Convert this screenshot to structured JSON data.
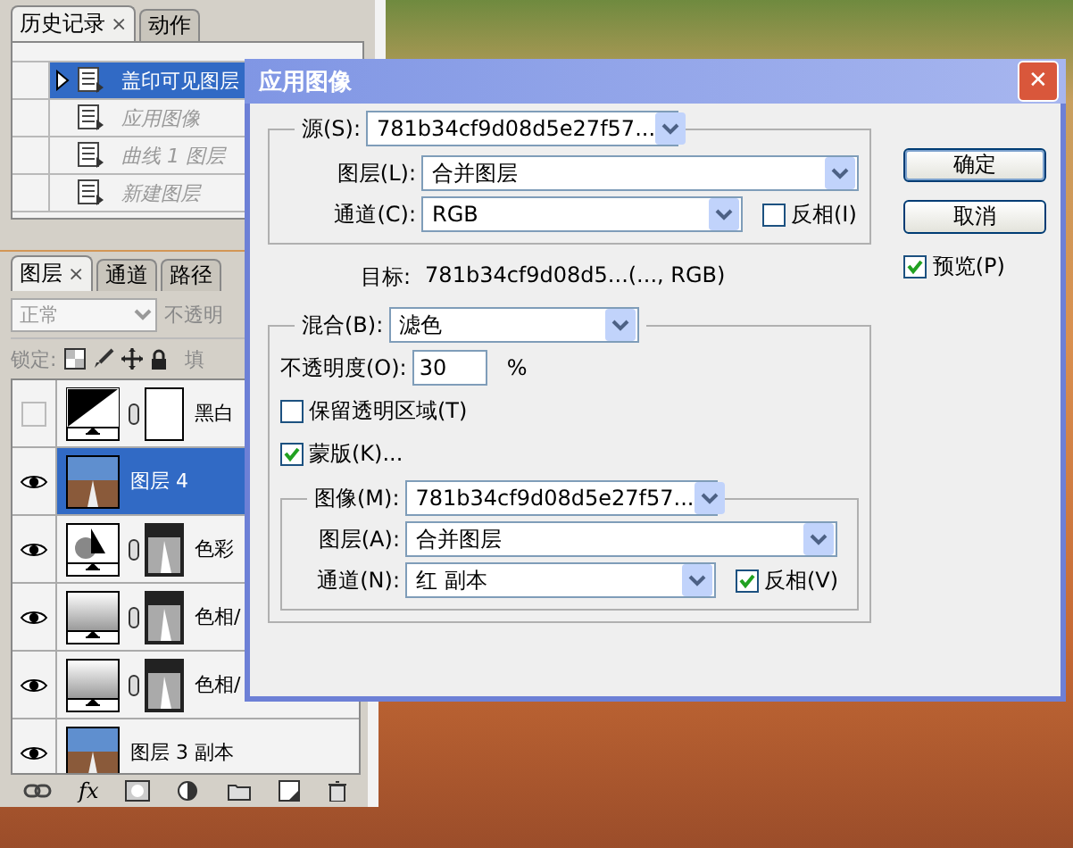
{
  "history_panel": {
    "tabs": [
      {
        "label": "历史记录",
        "selected": true,
        "close": "×"
      },
      {
        "label": "动作",
        "selected": false
      }
    ],
    "items": [
      {
        "label": "盖印可见图层",
        "selected": true,
        "undone": false
      },
      {
        "label": "应用图像",
        "selected": false,
        "undone": true
      },
      {
        "label": "曲线 1 图层",
        "selected": false,
        "undone": true
      },
      {
        "label": "新建图层",
        "selected": false,
        "undone": true
      }
    ]
  },
  "layers_panel": {
    "tabs": [
      {
        "label": "图层",
        "selected": true,
        "close": "×"
      },
      {
        "label": "通道",
        "selected": false
      },
      {
        "label": "路径",
        "selected": false
      }
    ],
    "effects_button": "fx",
    "blend_mode": {
      "value": "正常",
      "disabled": true
    },
    "opacity_label": "不透明",
    "lock_label": "锁定:",
    "fill_label": "填",
    "layers": [
      {
        "name": "黑白",
        "kind": "bw",
        "mask": {
          "kind": "white"
        },
        "visible": false,
        "selected": false
      },
      {
        "name": "图层 4",
        "kind": "photo",
        "visible": true,
        "selected": true
      },
      {
        "name": "色彩",
        "kind": "balance",
        "mask": {
          "kind": "image"
        },
        "visible": true,
        "selected": false
      },
      {
        "name": "色相/",
        "kind": "hue",
        "mask": {
          "kind": "image"
        },
        "visible": true,
        "selected": false
      },
      {
        "name": "色相/",
        "kind": "hue",
        "mask": {
          "kind": "image"
        },
        "visible": true,
        "selected": false
      },
      {
        "name": "图层 3 副本",
        "kind": "photo",
        "visible": true,
        "selected": false
      }
    ]
  },
  "dialog": {
    "title": "应用图像",
    "close": "✕",
    "source": {
      "label": "源(S):",
      "value": "781b34cf9d08d5e27f57..."
    },
    "layer": {
      "label": "图层(L):",
      "value": "合并图层"
    },
    "channel": {
      "label": "通道(C):",
      "value": "RGB"
    },
    "invert": {
      "label": "反相(I)",
      "checked": false
    },
    "target": {
      "label": "目标:",
      "value": "781b34cf9d08d5...(..., RGB)"
    },
    "blending": {
      "label": "混合(B):",
      "value": "滤色"
    },
    "opacity": {
      "label": "不透明度(O):",
      "value": "30",
      "unit": "%"
    },
    "preserve_transparency": {
      "label": "保留透明区域(T)",
      "checked": false
    },
    "mask": {
      "label": "蒙版(K)...",
      "checked": true
    },
    "mask_image": {
      "label": "图像(M):",
      "value": "781b34cf9d08d5e27f57..."
    },
    "mask_layer": {
      "label": "图层(A):",
      "value": "合并图层"
    },
    "mask_channel": {
      "label": "通道(N):",
      "value": "红 副本"
    },
    "mask_invert": {
      "label": "反相(V)",
      "checked": true
    },
    "buttons": [
      {
        "label": "确定",
        "default": true
      },
      {
        "label": "取消",
        "default": false
      }
    ],
    "preview": {
      "label": "预览(P)",
      "checked": true
    }
  }
}
